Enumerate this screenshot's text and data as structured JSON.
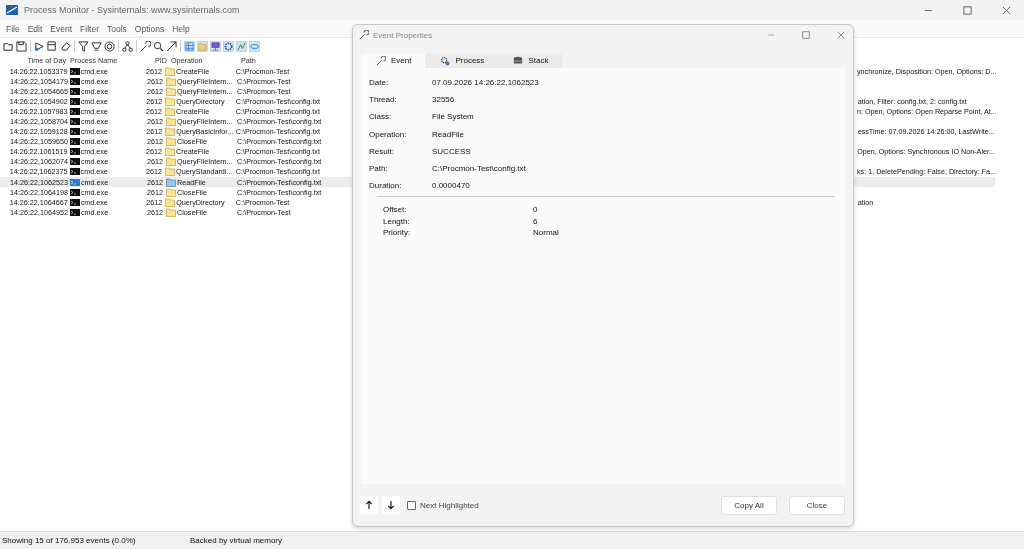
{
  "window": {
    "title": "Process Monitor - Sysinternals: www.sysinternals.com"
  },
  "menu": [
    "File",
    "Edit",
    "Event",
    "Filter",
    "Tools",
    "Options",
    "Help"
  ],
  "table": {
    "columns": [
      "Time of Day",
      "Process Name",
      "PID",
      "Operation",
      "Path"
    ],
    "rows": [
      {
        "time": "14:26:22,1053379",
        "process": "cmd.exe",
        "pid": "2612",
        "operation": "CreateFile",
        "path": "C:\\Procmon-Test",
        "detail": "ynchronize, Disposition: Open, Options: D...",
        "selected": false
      },
      {
        "time": "14:26:22,1054179",
        "process": "cmd.exe",
        "pid": "2612",
        "operation": "QueryFileIntern...",
        "path": "C:\\Procmon-Test",
        "selected": false
      },
      {
        "time": "14:26:22,1054665",
        "process": "cmd.exe",
        "pid": "2612",
        "operation": "QueryFileIntern...",
        "path": "C:\\Procmon-Test",
        "selected": false
      },
      {
        "time": "14:26:22,1054902",
        "process": "cmd.exe",
        "pid": "2612",
        "operation": "QueryDirectory",
        "path": "C:\\Procmon-Test\\config.txt",
        "detail": "ation, Filter: config.txt, 2: config.txt",
        "selected": false
      },
      {
        "time": "14:26:22,1057983",
        "process": "cmd.exe",
        "pid": "2612",
        "operation": "CreateFile",
        "path": "C:\\Procmon-Test\\config.txt",
        "detail": "n: Open, Options: Open Reparse Point, At...",
        "selected": false
      },
      {
        "time": "14:26:22,1058704",
        "process": "cmd.exe",
        "pid": "2612",
        "operation": "QueryFileIntern...",
        "path": "C:\\Procmon-Test\\config.txt",
        "selected": false
      },
      {
        "time": "14:26:22,1059128",
        "process": "cmd.exe",
        "pid": "2612",
        "operation": "QueryBasicInfor...",
        "path": "C:\\Procmon-Test\\config.txt",
        "detail": "essTime: 07.09.2026 14:26:00, LastWrite...",
        "selected": false
      },
      {
        "time": "14:26:22,1059650",
        "process": "cmd.exe",
        "pid": "2612",
        "operation": "CloseFile",
        "path": "C:\\Procmon-Test\\config.txt",
        "selected": false
      },
      {
        "time": "14:26:22,1061519",
        "process": "cmd.exe",
        "pid": "2612",
        "operation": "CreateFile",
        "path": "C:\\Procmon-Test\\config.txt",
        "detail": "Open, Options: Synchronous IO Non-Aler...",
        "selected": false
      },
      {
        "time": "14:26:22,1062074",
        "process": "cmd.exe",
        "pid": "2612",
        "operation": "QueryFileIntern...",
        "path": "C:\\Procmon-Test\\config.txt",
        "selected": false
      },
      {
        "time": "14:26:22,1062375",
        "process": "cmd.exe",
        "pid": "2612",
        "operation": "QueryStandardI...",
        "path": "C:\\Procmon-Test\\config.txt",
        "detail": "ks: 1, DeletePending: False, Directory: Fa...",
        "selected": false
      },
      {
        "time": "14:26:22,1062523",
        "process": "cmd.exe",
        "pid": "2612",
        "operation": "ReadFile",
        "path": "C:\\Procmon-Test\\config.txt",
        "selected": true
      },
      {
        "time": "14:26:22,1064198",
        "process": "cmd.exe",
        "pid": "2612",
        "operation": "CloseFile",
        "path": "C:\\Procmon-Test\\config.txt",
        "selected": false
      },
      {
        "time": "14:26:22,1064667",
        "process": "cmd.exe",
        "pid": "2612",
        "operation": "QueryDirectory",
        "path": "C:\\Procmon-Test",
        "detail": "ation",
        "selected": false
      },
      {
        "time": "14:26:22,1064952",
        "process": "cmd.exe",
        "pid": "2612",
        "operation": "CloseFile",
        "path": "C:\\Procmon-Test",
        "selected": false
      }
    ]
  },
  "status_bar": [
    "Showing 15 of 176.953 events (0.0%)",
    "Backed by virtual memory"
  ],
  "dialog": {
    "title": "Event Properties",
    "tabs": [
      {
        "label": "Event",
        "kind": "wrench",
        "selected": true
      },
      {
        "label": "Process",
        "kind": "gear",
        "selected": false
      },
      {
        "label": "Stack",
        "kind": "stack",
        "selected": false
      }
    ],
    "fields": [
      {
        "label": "Date:",
        "value": "07.09.2026 14:26:22,1062523"
      },
      {
        "label": "Thread:",
        "value": "32556"
      },
      {
        "label": "Class:",
        "value": "File System"
      },
      {
        "label": "Operation:",
        "value": "ReadFile"
      },
      {
        "label": "Result:",
        "value": "SUCCESS"
      },
      {
        "label": "Path:",
        "value": "C:\\Procmon-Test\\config.txt"
      },
      {
        "label": "Duration:",
        "value": "0.0000470"
      }
    ],
    "details": [
      {
        "label": "Offset:",
        "value": "0"
      },
      {
        "label": "Length:",
        "value": "6"
      },
      {
        "label": "Priority:",
        "value": "Normal"
      }
    ],
    "next_highlighted": {
      "label": "Next Highlighted",
      "checked": false
    },
    "buttons": [
      "Copy All",
      "Close"
    ]
  }
}
